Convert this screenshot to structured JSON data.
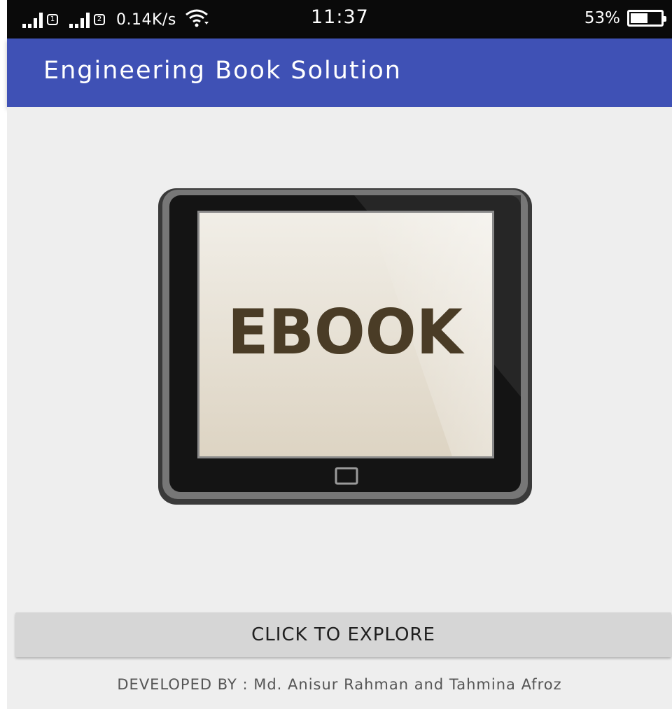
{
  "status_bar": {
    "net_speed": "0.14K/s",
    "time": "11:37",
    "battery_level": "53%",
    "sim1_label": "1",
    "sim2_label": "2",
    "icons": [
      "signal-icon",
      "wifi-icon",
      "battery-icon"
    ]
  },
  "app_bar": {
    "title": "Engineering Book Solution",
    "color": "#3f51b5"
  },
  "hero": {
    "screen_text": "EBOOK"
  },
  "explore_button": {
    "label": "CLICK TO EXPLORE"
  },
  "footer": {
    "credit": "DEVELOPED BY : Md. Anisur Rahman and Tahmina Afroz"
  },
  "colors": {
    "content_bg": "#eeeeee",
    "button_bg": "#d6d6d6",
    "ebook_text": "#4a3c26"
  }
}
